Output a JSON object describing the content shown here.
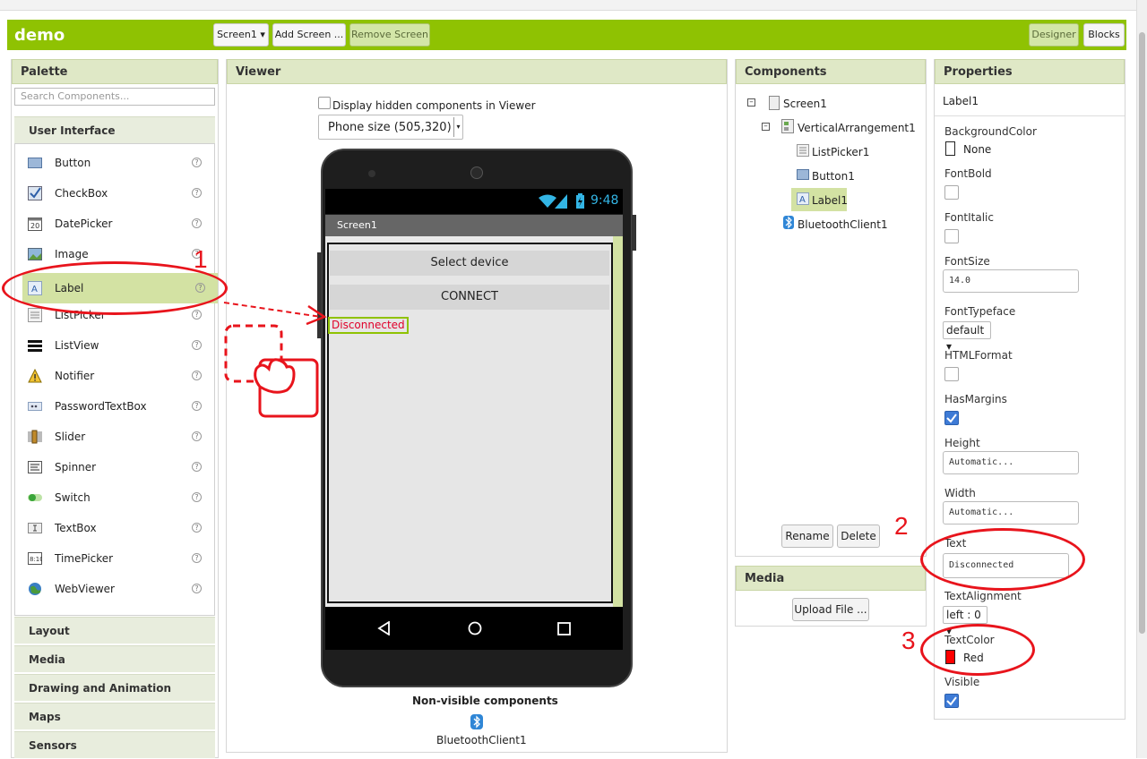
{
  "app": {
    "title": "demo",
    "screen_select": "Screen1 ▾",
    "add_screen": "Add Screen ...",
    "remove_screen": "Remove Screen",
    "designer": "Designer",
    "blocks": "Blocks"
  },
  "palette": {
    "header": "Palette",
    "search_placeholder": "Search Components...",
    "category_open": "User Interface",
    "items": [
      {
        "label": "Button",
        "icon": "button-icon"
      },
      {
        "label": "CheckBox",
        "icon": "checkbox-icon"
      },
      {
        "label": "DatePicker",
        "icon": "datepicker-icon"
      },
      {
        "label": "Image",
        "icon": "image-icon"
      },
      {
        "label": "Label",
        "icon": "label-icon"
      },
      {
        "label": "ListPicker",
        "icon": "listpicker-icon"
      },
      {
        "label": "ListView",
        "icon": "listview-icon"
      },
      {
        "label": "Notifier",
        "icon": "notifier-icon"
      },
      {
        "label": "PasswordTextBox",
        "icon": "password-icon"
      },
      {
        "label": "Slider",
        "icon": "slider-icon"
      },
      {
        "label": "Spinner",
        "icon": "spinner-icon"
      },
      {
        "label": "Switch",
        "icon": "switch-icon"
      },
      {
        "label": "TextBox",
        "icon": "textbox-icon"
      },
      {
        "label": "TimePicker",
        "icon": "timepicker-icon"
      },
      {
        "label": "WebViewer",
        "icon": "webviewer-icon"
      }
    ],
    "help_glyph": "?",
    "categories": [
      "Layout",
      "Media",
      "Drawing and Animation",
      "Maps",
      "Sensors"
    ]
  },
  "viewer": {
    "header": "Viewer",
    "hidden_checkbox_label": "Display hidden components in Viewer",
    "size_select": "Phone size (505,320)",
    "clock": "9:48",
    "screen_title": "Screen1",
    "select_device": "Select device",
    "connect": "CONNECT",
    "label_text": "Disconnected",
    "nonvisible_header": "Non-visible components",
    "nonvisible_item": "BluetoothClient1"
  },
  "components": {
    "header": "Components",
    "tree": {
      "screen": "Screen1",
      "vertical": "VerticalArrangement1",
      "listpicker": "ListPicker1",
      "button": "Button1",
      "label": "Label1",
      "bluetooth": "BluetoothClient1"
    },
    "rename": "Rename",
    "delete": "Delete"
  },
  "media": {
    "header": "Media",
    "upload": "Upload File ..."
  },
  "properties": {
    "header": "Properties",
    "component": "Label1",
    "background_color": "BackgroundColor",
    "background_value": "None",
    "font_bold": "FontBold",
    "font_italic": "FontItalic",
    "font_size": "FontSize",
    "font_size_value": "14.0",
    "font_typeface": "FontTypeface",
    "font_typeface_value": "default ▾",
    "html_format": "HTMLFormat",
    "has_margins": "HasMargins",
    "height": "Height",
    "height_value": "Automatic...",
    "width": "Width",
    "width_value": "Automatic...",
    "text": "Text",
    "text_value": "Disconnected",
    "text_alignment": "TextAlignment",
    "text_alignment_value": "left : 0 ▾",
    "text_color": "TextColor",
    "text_color_value": "Red",
    "visible": "Visible"
  },
  "annotations": {
    "step1": "1",
    "step2": "2",
    "step3": "3"
  },
  "colors": {
    "accent": "#8fc202",
    "annotation": "#e8141c",
    "label_text": "#e0002a",
    "text_color_swatch": "#ff0000"
  }
}
